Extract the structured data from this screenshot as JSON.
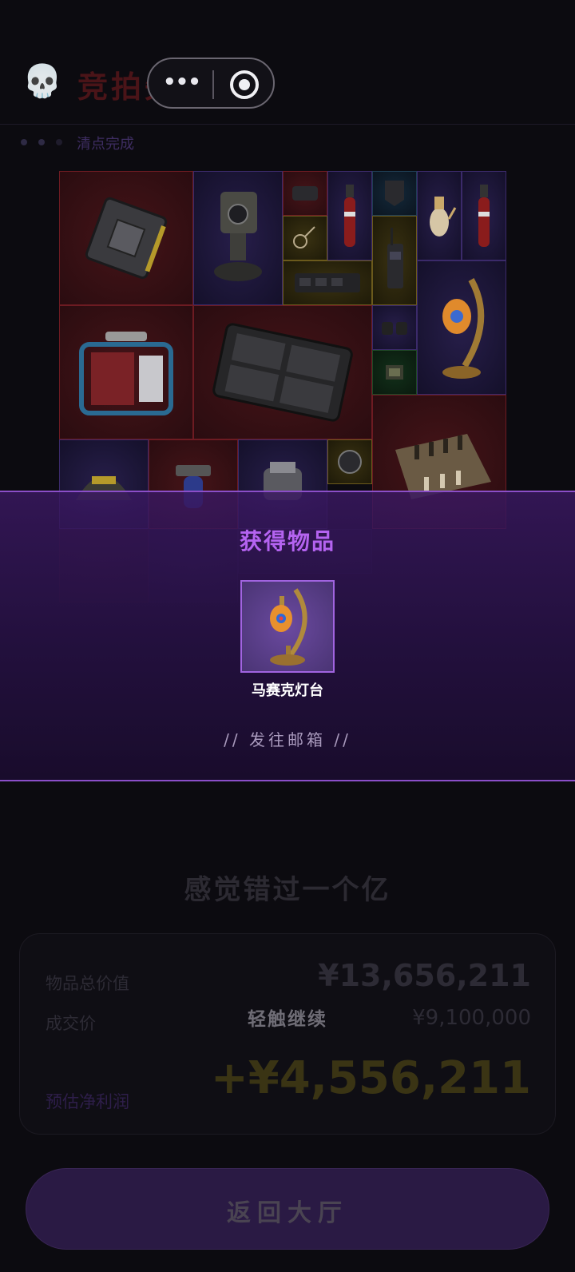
{
  "header": {
    "title": "竞拍失败",
    "skull_icon": "skull-icon",
    "progress_label": "清点完成"
  },
  "capsule": {
    "more_icon": "more-dots-icon",
    "close_icon": "target-close-icon",
    "dots_text": "•••"
  },
  "grid": {
    "items": [
      {
        "icon": "rugged-laptop-case",
        "tier": "red"
      },
      {
        "icon": "security-camera",
        "tier": "purple"
      },
      {
        "icon": "gadget",
        "tier": "red"
      },
      {
        "icon": "fire-extinguisher",
        "tier": "purple"
      },
      {
        "icon": "holster",
        "tier": "blue"
      },
      {
        "icon": "teapot",
        "tier": "purple"
      },
      {
        "icon": "fire-extinguisher",
        "tier": "purple"
      },
      {
        "icon": "keyring",
        "tier": "gold"
      },
      {
        "icon": "walkie-talkie",
        "tier": "gold"
      },
      {
        "icon": "circuit-board",
        "tier": "gold"
      },
      {
        "icon": "mosaic-lamp",
        "tier": "purple"
      },
      {
        "icon": "generator",
        "tier": "red"
      },
      {
        "icon": "hard-case",
        "tier": "red"
      },
      {
        "icon": "binoculars",
        "tier": "purple"
      },
      {
        "icon": "chip",
        "tier": "green"
      },
      {
        "icon": "chess-board",
        "tier": "red"
      },
      {
        "icon": "helmet",
        "tier": "purple"
      },
      {
        "icon": "camp-stove",
        "tier": "red"
      },
      {
        "icon": "scanner",
        "tier": "purple"
      },
      {
        "icon": "gauge",
        "tier": "gold"
      }
    ]
  },
  "modal": {
    "title": "获得物品",
    "item_name": "马赛克灯台",
    "item_icon": "mosaic-lamp-icon",
    "mail_link": "// 发往邮箱 //"
  },
  "result": {
    "headline": "感觉错过一个亿",
    "total_value_label": "物品总价值",
    "total_value": "¥13,656,211",
    "deal_price_label": "成交价",
    "deal_price": "¥9,100,000",
    "profit_label": "预估净利润",
    "profit": "+¥4,556,211",
    "tap_continue": "轻触继续"
  },
  "footer": {
    "return_label": "返回大厅"
  },
  "colors": {
    "accent_purple": "#b463f0",
    "fail_red": "#4a1418",
    "band_border": "#8b4ec8"
  }
}
